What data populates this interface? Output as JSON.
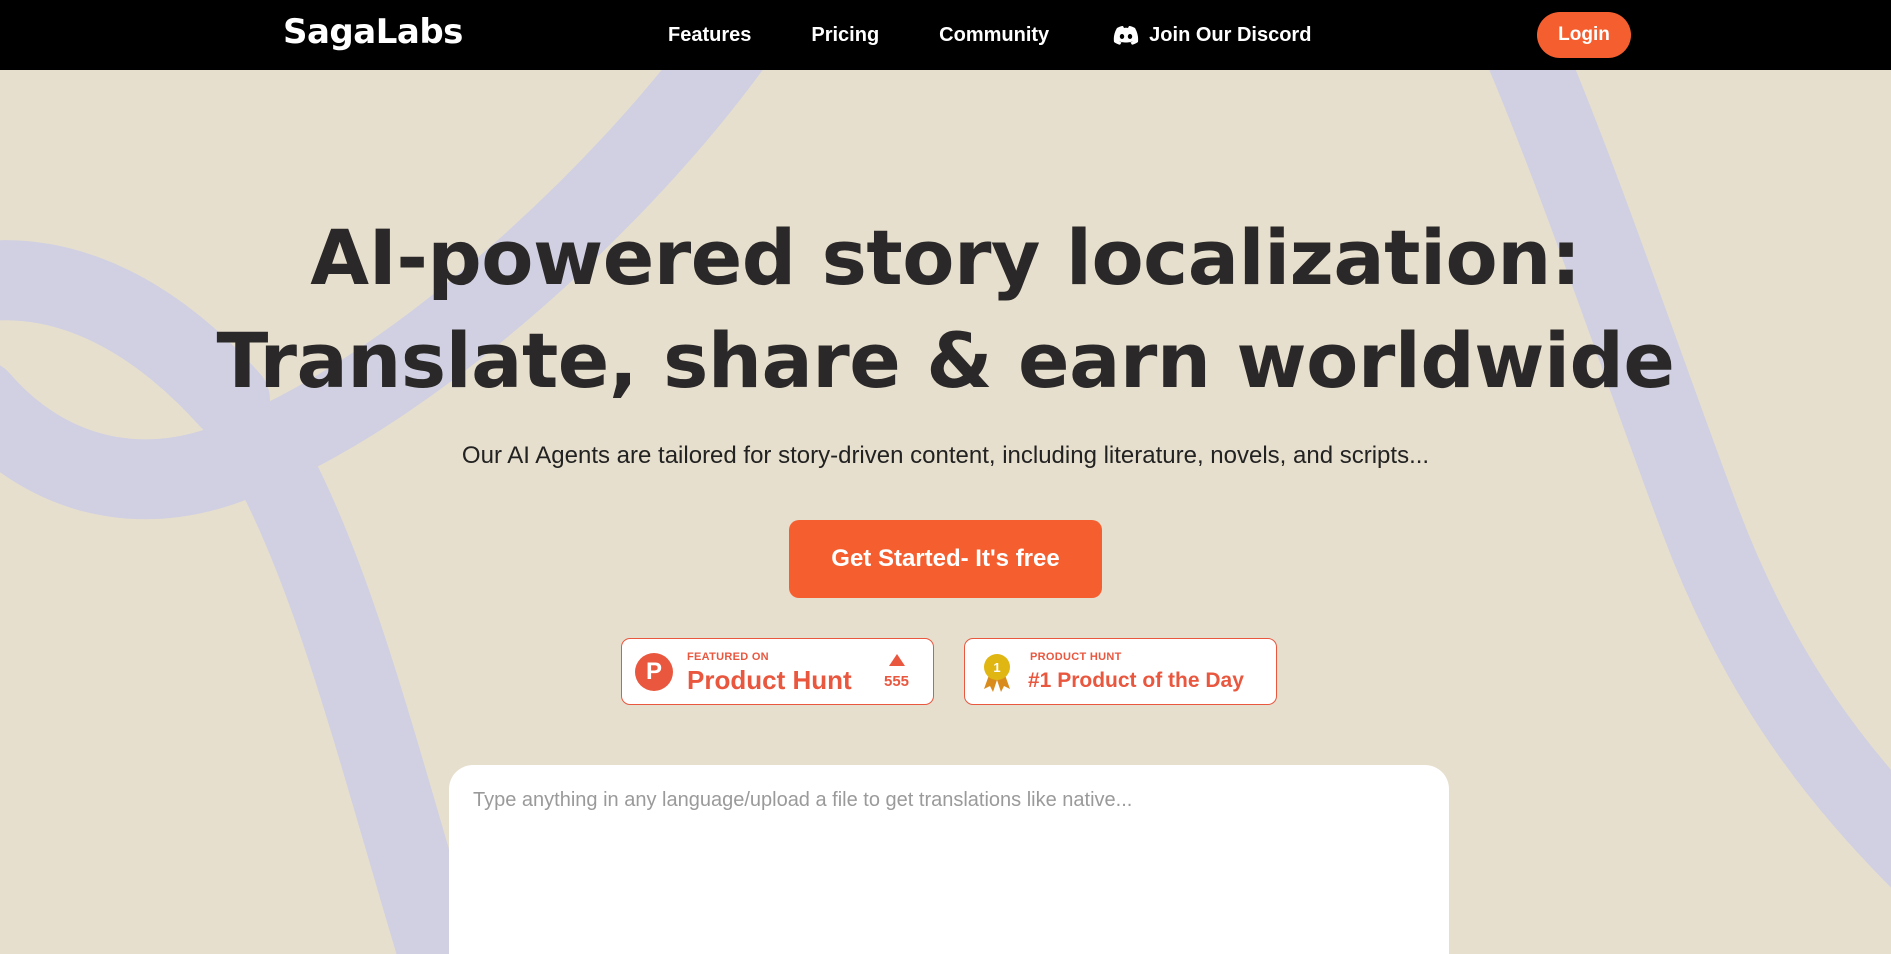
{
  "nav": {
    "logo": "SagaLabs",
    "links": [
      "Features",
      "Pricing",
      "Community"
    ],
    "discord_label": "Join Our Discord",
    "login_label": "Login"
  },
  "hero": {
    "headline_line1": "AI-powered story localization:",
    "headline_line2": "Translate, share & earn worldwide",
    "subtitle": "Our AI Agents are tailored for story-driven content, including literature, novels, and scripts...",
    "cta_label": "Get Started- It's free"
  },
  "badges": {
    "product_hunt": {
      "small": "FEATURED ON",
      "big": "Product Hunt",
      "letter": "P",
      "upvotes": "555"
    },
    "product_of_day": {
      "small": "PRODUCT HUNT",
      "big": "#1 Product of the Day",
      "rank": "1"
    }
  },
  "input": {
    "placeholder": "Type anything in any language/upload a file to get translations like native..."
  },
  "colors": {
    "background": "#e7dfcd",
    "nav_bg": "#000000",
    "accent": "#f55f2f",
    "product_hunt": "#e9573f",
    "curve": "#d0d0e2",
    "medal": "#e0b613"
  },
  "icons": [
    "discord-icon",
    "product-hunt-logo",
    "upvote-arrow-icon",
    "medal-icon"
  ]
}
